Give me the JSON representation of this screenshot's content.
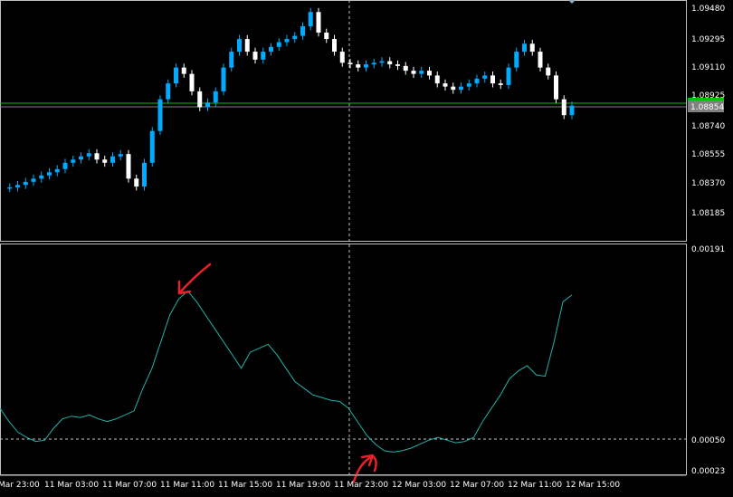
{
  "main_panel": {
    "price_labels": [
      "1.09480",
      "1.09295",
      "1.09110",
      "1.08925",
      "1.08740",
      "1.08555",
      "1.08370",
      "1.08185"
    ],
    "bid_price": "1.08854",
    "bid_badge_color": "#808080",
    "ask_line_color": "#00c000",
    "bull_color": "#00aaff",
    "bear_color": "#ffffff"
  },
  "indicator_panel": {
    "labels": [
      "0.00191",
      "0.00050",
      "0.00023"
    ],
    "line_color": "#20b2aa",
    "level_value": 0.0005
  },
  "time_labels": [
    "Mar 23:00",
    "11 Mar 03:00",
    "11 Mar 07:00",
    "11 Mar 11:00",
    "11 Mar 15:00",
    "11 Mar 19:00",
    "11 Mar 23:00",
    "12 Mar 03:00",
    "12 Mar 07:00",
    "12 Mar 11:00",
    "12 Mar 15:00"
  ],
  "annotations": {
    "arrow_color": "#e8202a",
    "arrows": [
      "peak-arrow",
      "trough-arrow"
    ]
  },
  "chart_data": {
    "type": "line",
    "price_series": [
      1.0834,
      1.08345,
      1.0836,
      1.0838,
      1.084,
      1.0842,
      1.0844,
      1.0846,
      1.085,
      1.0852,
      1.0854,
      1.0856,
      1.0852,
      1.085,
      1.0854,
      1.08555,
      1.084,
      1.0835,
      1.085,
      1.087,
      1.089,
      1.09,
      1.091,
      1.0906,
      1.0895,
      1.0885,
      1.0888,
      1.0895,
      1.091,
      1.092,
      1.0928,
      1.092,
      1.0915,
      1.092,
      1.0923,
      1.0926,
      1.0928,
      1.093,
      1.0936,
      1.0945,
      1.0932,
      1.0928,
      1.092,
      1.0913,
      1.0912,
      1.091,
      1.0912,
      1.0913,
      1.0914,
      1.0912,
      1.0911,
      1.0908,
      1.0906,
      1.0908,
      1.0905,
      1.09,
      1.0898,
      1.0896,
      1.0898,
      1.09,
      1.0903,
      1.0905,
      1.09,
      1.0899,
      1.091,
      1.092,
      1.0925,
      1.092,
      1.091,
      1.0905,
      1.089,
      1.088,
      1.0886
    ],
    "oscillator_series": [
      0.0007,
      0.0006,
      0.00052,
      0.00048,
      0.00045,
      0.00046,
      0.00055,
      0.00062,
      0.00064,
      0.00063,
      0.00065,
      0.00062,
      0.0006,
      0.00062,
      0.00065,
      0.00068,
      0.00085,
      0.001,
      0.0012,
      0.0014,
      0.00152,
      0.00158,
      0.0015,
      0.0014,
      0.0013,
      0.0012,
      0.0011,
      0.001,
      0.00112,
      0.00115,
      0.00118,
      0.0011,
      0.001,
      0.0009,
      0.00085,
      0.0008,
      0.00078,
      0.00076,
      0.00075,
      0.0007,
      0.0006,
      0.0005,
      0.00043,
      0.00038,
      0.00037,
      0.00038,
      0.0004,
      0.00043,
      0.00046,
      0.00048,
      0.00046,
      0.00044,
      0.00045,
      0.00048,
      0.0006,
      0.0007,
      0.0008,
      0.00092,
      0.00098,
      0.00102,
      0.00095,
      0.00094,
      0.0012,
      0.0015,
      0.00155
    ]
  }
}
